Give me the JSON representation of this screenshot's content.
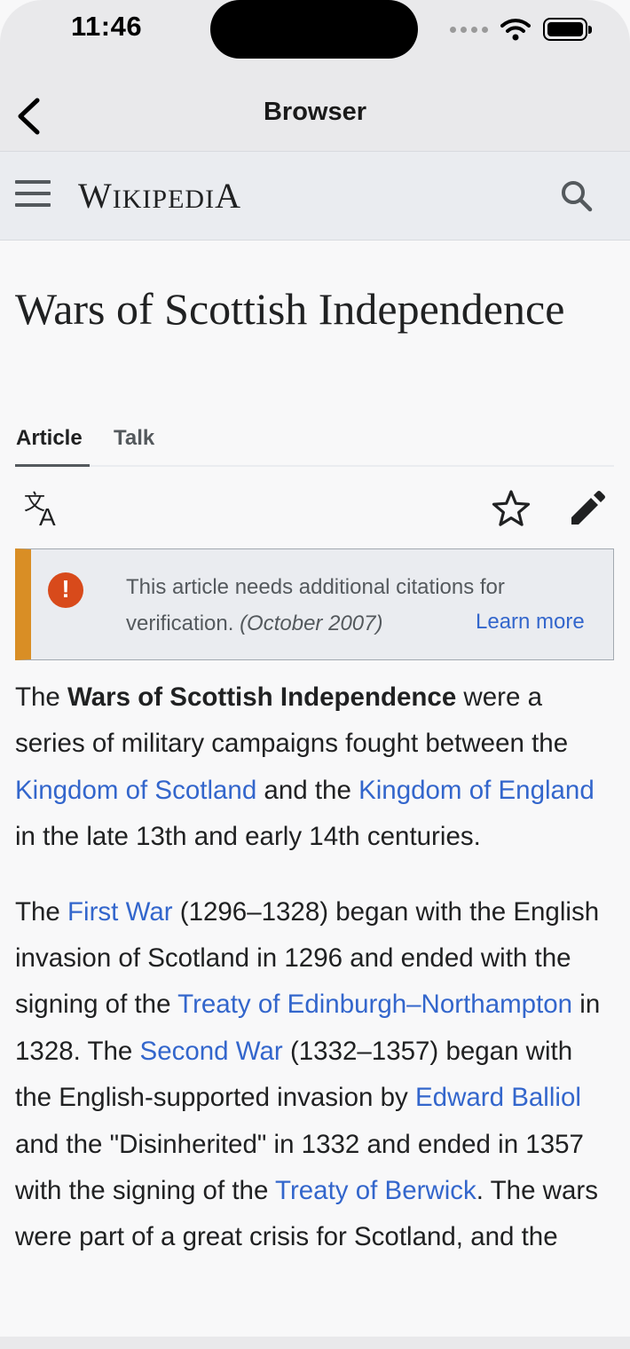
{
  "status": {
    "time": "11:46"
  },
  "browser": {
    "title": "Browser"
  },
  "wiki": {
    "wordmark_big": "W",
    "wordmark_mid": "IKIPEDI",
    "wordmark_end": "A"
  },
  "article": {
    "title": "Wars of Scottish Independence",
    "tabs": [
      {
        "label": "Article"
      },
      {
        "label": "Talk"
      }
    ],
    "notice": {
      "text": "This article needs additional citations for verification.",
      "date": "(October 2007)",
      "link": "Learn more"
    },
    "paragraphs": [
      [
        {
          "t": "The "
        },
        {
          "t": "Wars of Scottish Independence",
          "b": true
        },
        {
          "t": " were a series of military campaigns fought between the "
        },
        {
          "t": "Kingdom of Scotland",
          "link": true
        },
        {
          "t": " and the "
        },
        {
          "t": "Kingdom of England",
          "link": true
        },
        {
          "t": " in the late 13th and early 14th centuries."
        }
      ],
      [
        {
          "t": "The "
        },
        {
          "t": "First War",
          "link": true
        },
        {
          "t": " (1296–1328) began with the English invasion of Scotland in 1296 and ended with the signing of the "
        },
        {
          "t": "Treaty of Edinburgh–Northampton",
          "link": true
        },
        {
          "t": " in 1328. The "
        },
        {
          "t": "Second War",
          "link": true
        },
        {
          "t": " (1332–1357) began with the English-supported invasion by "
        },
        {
          "t": "Edward Balliol",
          "link": true
        },
        {
          "t": " and the \"Disinherited\" in 1332 and ended in 1357 with the signing of the "
        },
        {
          "t": "Treaty of Berwick",
          "link": true
        },
        {
          "t": ". The wars were part of a great crisis for Scotland, and the"
        }
      ]
    ]
  },
  "colors": {
    "link": "#3366cc",
    "notice_accent": "#d98e25",
    "notice_icon": "#d84a1b"
  },
  "icons": [
    "back-chevron-icon",
    "menu-icon",
    "search-icon",
    "translate-icon",
    "star-icon",
    "edit-pencil-icon",
    "warning-icon",
    "wifi-icon",
    "battery-icon"
  ]
}
